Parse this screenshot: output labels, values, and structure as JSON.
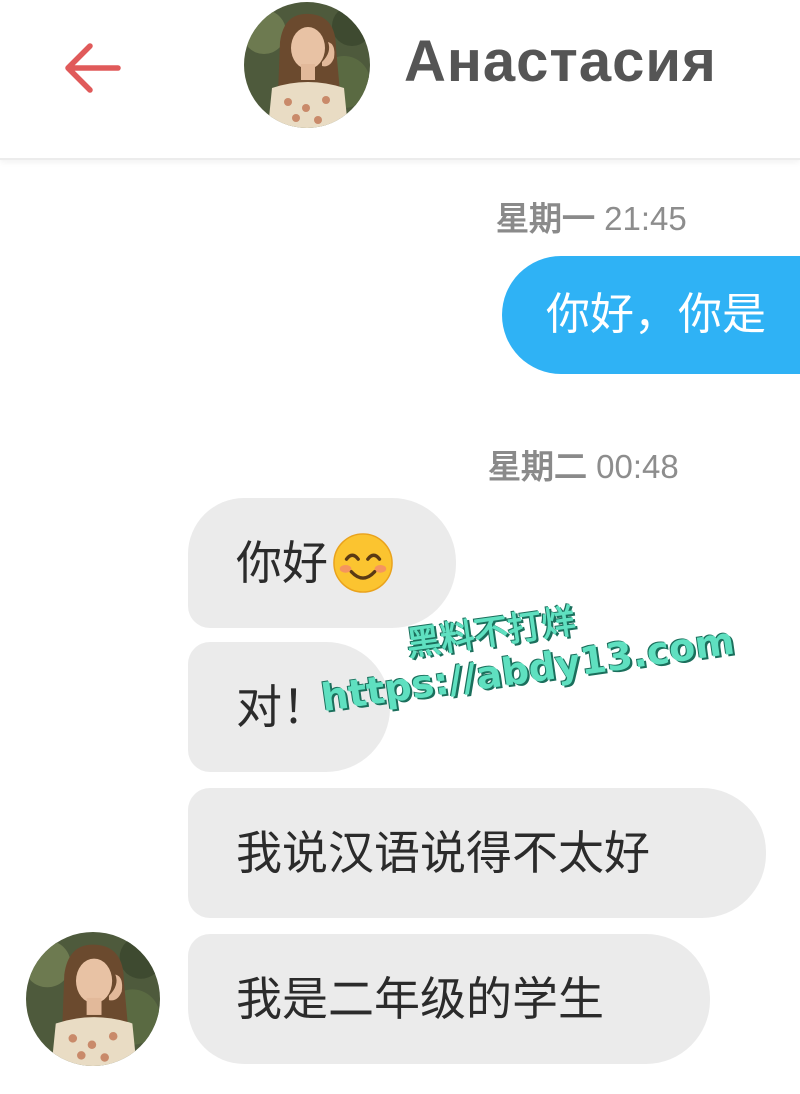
{
  "header": {
    "back_icon": "arrow-left-icon",
    "contact_name": "Анастасия",
    "accent_color": "#e05a5a"
  },
  "messages": [
    {
      "timestamp_day": "星期一",
      "timestamp_time": "21:45",
      "direction": "outgoing",
      "text": "你好，你是"
    },
    {
      "timestamp_day": "星期二",
      "timestamp_time": "00:48",
      "direction": "incoming",
      "text": "你好",
      "emoji": "smiling-face-icon"
    },
    {
      "direction": "incoming",
      "text": "对！"
    },
    {
      "direction": "incoming",
      "text": "我说汉语说得不太好"
    },
    {
      "direction": "incoming",
      "text": "我是二年级的学生"
    }
  ],
  "watermark": {
    "line1": "黑料不打烊",
    "line2": "https://abdy13.com"
  },
  "colors": {
    "outgoing_bubble": "#2fb2f5",
    "incoming_bubble": "#ebebeb",
    "watermark": "#5fe0c0"
  }
}
